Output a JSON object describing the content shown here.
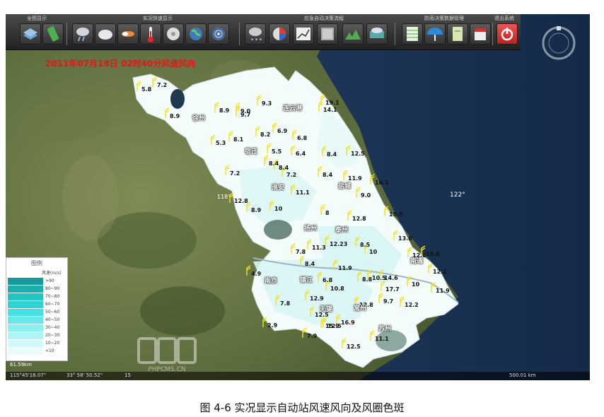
{
  "toolbar": {
    "groups": [
      {
        "label": "全图显示"
      },
      {
        "label": "实况快速显示"
      },
      {
        "label": "应急自动决策流程"
      },
      {
        "label": "防雨决策数据管理"
      },
      {
        "label": "退出系统"
      }
    ],
    "buttons": [
      {
        "icon": "layers-icon"
      },
      {
        "icon": "globe-icon"
      },
      {
        "icon": "rain-cloud-icon"
      },
      {
        "icon": "cloud-icon"
      },
      {
        "icon": "wind-icon"
      },
      {
        "icon": "thermometer-icon"
      },
      {
        "icon": "typhoon-icon"
      },
      {
        "icon": "earth-icon"
      },
      {
        "icon": "radar-icon"
      },
      {
        "icon": "snow-cloud-icon"
      },
      {
        "icon": "chart-icon"
      },
      {
        "icon": "line-chart-icon"
      },
      {
        "icon": "map-sheet-icon"
      },
      {
        "icon": "terrain-icon"
      },
      {
        "icon": "sat-icon"
      },
      {
        "icon": "spreadsheet-icon"
      },
      {
        "icon": "umbrella-icon"
      },
      {
        "icon": "notebook-icon"
      },
      {
        "icon": "calendar-icon"
      },
      {
        "icon": "power-icon"
      }
    ]
  },
  "map": {
    "title": "2011年07月18日 02时40分风速风向",
    "lon_label": "122°",
    "lon_left": "118°",
    "stations": [
      {
        "v": "5.8"
      },
      {
        "v": "7.2"
      },
      {
        "v": "8.9"
      },
      {
        "v": "9.0"
      },
      {
        "v": "8.9"
      },
      {
        "v": "9.7"
      },
      {
        "v": "9.3"
      },
      {
        "v": "14.1"
      },
      {
        "v": "19.1"
      },
      {
        "v": "5.3"
      },
      {
        "v": "8.1"
      },
      {
        "v": "8.2"
      },
      {
        "v": "6.9"
      },
      {
        "v": "5.5"
      },
      {
        "v": "6.8"
      },
      {
        "v": "8.4"
      },
      {
        "v": "6.4"
      },
      {
        "v": "8.4"
      },
      {
        "v": "12.5"
      },
      {
        "v": "7.2"
      },
      {
        "v": "8.4"
      },
      {
        "v": "7.2"
      },
      {
        "v": "8.4"
      },
      {
        "v": "11.9"
      },
      {
        "v": "16.1"
      },
      {
        "v": "12.8"
      },
      {
        "v": "11.1"
      },
      {
        "v": "9.0"
      },
      {
        "v": "8.9"
      },
      {
        "v": "10"
      },
      {
        "v": "8"
      },
      {
        "v": "12.8"
      },
      {
        "v": "15.5"
      },
      {
        "v": "13.8"
      },
      {
        "v": "7.8"
      },
      {
        "v": "11.3"
      },
      {
        "v": "12.23"
      },
      {
        "v": "8.5"
      },
      {
        "v": "10"
      },
      {
        "v": "12.8"
      },
      {
        "v": "15.8"
      },
      {
        "v": "4.9"
      },
      {
        "v": "8.4"
      },
      {
        "v": "11.9"
      },
      {
        "v": "6.8"
      },
      {
        "v": "12.2"
      },
      {
        "v": "10.8"
      },
      {
        "v": "8.8"
      },
      {
        "v": "10.5"
      },
      {
        "v": "14.6"
      },
      {
        "v": "17.7"
      },
      {
        "v": "10"
      },
      {
        "v": "11.9"
      },
      {
        "v": "7.8"
      },
      {
        "v": "12.9"
      },
      {
        "v": "9.7"
      },
      {
        "v": "12.8"
      },
      {
        "v": "12.2"
      },
      {
        "v": "12.5"
      },
      {
        "v": "15.9"
      },
      {
        "v": "16.9"
      },
      {
        "v": "2.9"
      },
      {
        "v": "7.9"
      },
      {
        "v": "12.5"
      },
      {
        "v": "11.1"
      },
      {
        "v": "12.5"
      }
    ],
    "cities": [
      {
        "name": "徐州"
      },
      {
        "name": "连云港"
      },
      {
        "name": "宿迁"
      },
      {
        "name": "淮安"
      },
      {
        "name": "盐城"
      },
      {
        "name": "扬州"
      },
      {
        "name": "泰州"
      },
      {
        "name": "南通"
      },
      {
        "name": "南京"
      },
      {
        "name": "镇江"
      },
      {
        "name": "常州"
      },
      {
        "name": "无锡"
      },
      {
        "name": "苏州"
      }
    ]
  },
  "legend": {
    "title": "图例",
    "unit": "风速(m/s)",
    "rows": [
      {
        "label": ">90",
        "color": "#169a9c"
      },
      {
        "label": "80~90",
        "color": "#1bb0b0"
      },
      {
        "label": "70~80",
        "color": "#22c3c3"
      },
      {
        "label": "60~70",
        "color": "#2fd3d3"
      },
      {
        "label": "50~60",
        "color": "#45e0e0"
      },
      {
        "label": "40~50",
        "color": "#66e8ea"
      },
      {
        "label": "30~40",
        "color": "#8cf0f0"
      },
      {
        "label": "20~30",
        "color": "#b0f5f5"
      },
      {
        "label": "10~20",
        "color": "#d1f9f9"
      },
      {
        "label": "<10",
        "color": "#eafcfc"
      }
    ]
  },
  "status": {
    "scale_left": "61.59km",
    "coord1": "115°45'18.07\"",
    "coord2": "33° 58' 50.52\"",
    "coord3": "15",
    "scale_right": "500.01 km"
  },
  "watermark": {
    "text": "PHPCMS.CN"
  },
  "caption": "图 4-6 实况显示自动站风速风向及风圈色斑"
}
